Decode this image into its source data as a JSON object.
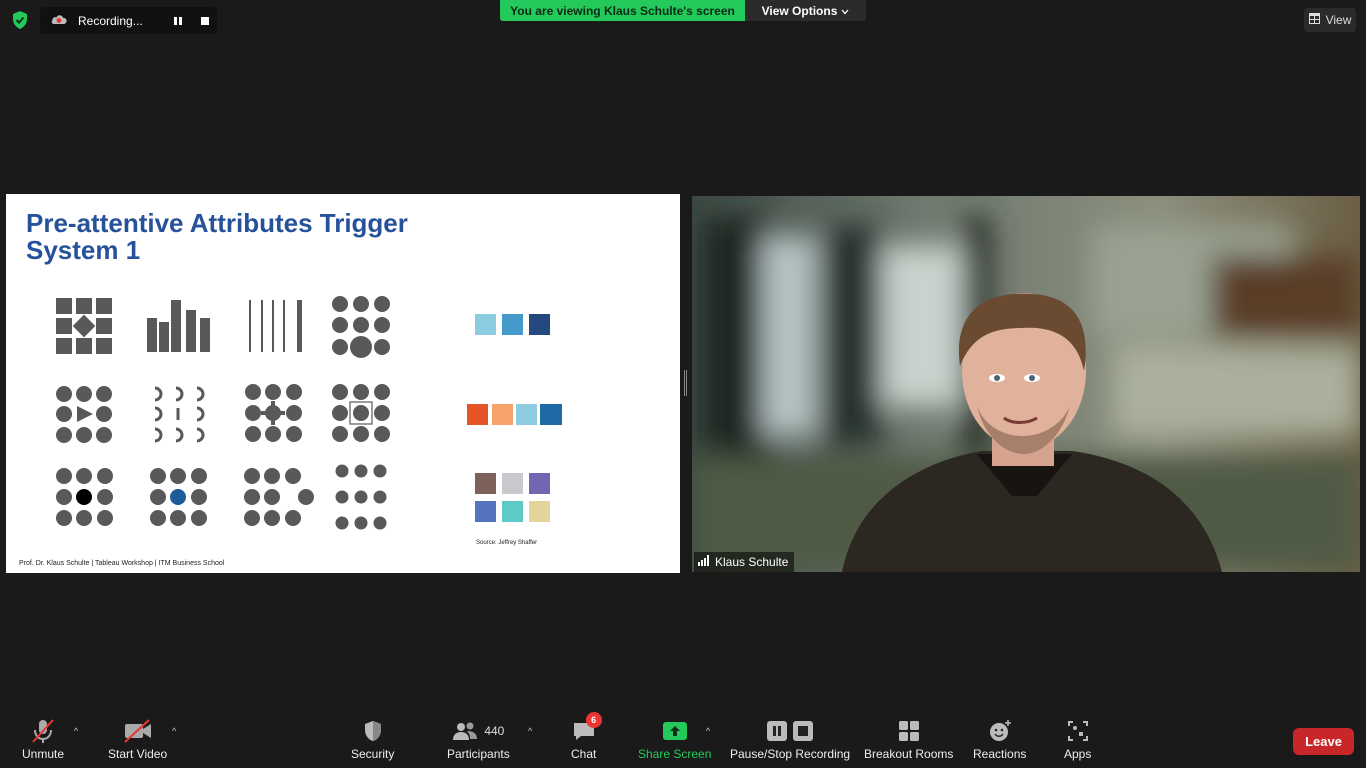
{
  "top": {
    "recording_label": "Recording...",
    "view_banner": "You are viewing Klaus Schulte's screen",
    "view_options": "View Options",
    "view_button": "View"
  },
  "slide": {
    "title_line1": "Pre-attentive Attributes Trigger",
    "title_line2": "System 1",
    "footer": "Prof. Dr. Klaus Schulte | Tableau Workshop | ITM Business School",
    "source": "Source: Jeffrey Shaffer",
    "colors": {
      "shape_gray": "#595959",
      "blue_light": "#8ccbe0",
      "blue_mid": "#4599cb",
      "blue_dark": "#23497f",
      "orange_red": "#e55527",
      "orange_light": "#f7a46a",
      "cat_brown": "#7d615b",
      "cat_gray": "#c9c8cc",
      "cat_purple": "#7066b1",
      "cat_blue": "#5474bf",
      "cat_teal": "#5fc9c7",
      "cat_sand": "#e4d39a",
      "highlight_blue": "#1d5b9a"
    }
  },
  "video": {
    "participant_name": "Klaus Schulte"
  },
  "toolbar": {
    "unmute": "Unmute",
    "start_video": "Start Video",
    "security": "Security",
    "participants": "Participants",
    "participants_count": "440",
    "chat": "Chat",
    "chat_badge": "6",
    "share_screen": "Share Screen",
    "pause_stop_recording": "Pause/Stop Recording",
    "breakout_rooms": "Breakout Rooms",
    "reactions": "Reactions",
    "apps": "Apps",
    "leave": "Leave"
  }
}
